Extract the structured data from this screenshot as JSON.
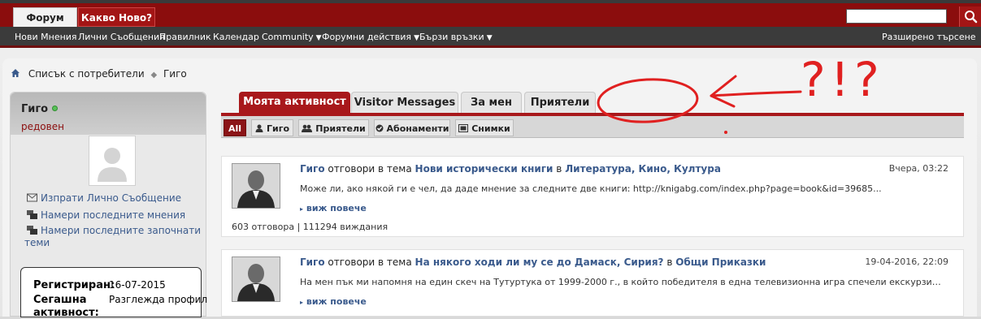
{
  "header": {
    "tabs": [
      {
        "label": "Форум"
      },
      {
        "label": "Какво Ново?"
      }
    ],
    "search_value": ""
  },
  "navbar": {
    "items": [
      {
        "label": "Нови Мнения"
      },
      {
        "label": "Лични Съобщения"
      },
      {
        "label": "Правилник"
      },
      {
        "label": "Календар"
      },
      {
        "label": "Community"
      },
      {
        "label": "Форумни действия"
      },
      {
        "label": "Бързи връзки"
      }
    ],
    "advanced_search": "Разширено търсене"
  },
  "breadcrumb": {
    "parent": "Списък с потребители",
    "current": "Гиго"
  },
  "sidebar": {
    "username": "Гиго",
    "user_title": "редовен",
    "links": [
      {
        "label": "Изпрати Лично Съобщение"
      },
      {
        "label": "Намери последните мнения"
      },
      {
        "label": "Намери последните започнати"
      },
      {
        "label": "теми"
      }
    ],
    "stats": [
      {
        "label": "Регистриран:",
        "value": "16-07-2015"
      },
      {
        "label": "Сегашна",
        "value": "Разглежда профил"
      },
      {
        "label": "активност:"
      }
    ]
  },
  "profile_tabs": [
    {
      "label": "Моята активност"
    },
    {
      "label": "Visitor Messages"
    },
    {
      "label": "За мен"
    },
    {
      "label": "Приятели"
    }
  ],
  "subtabs": [
    {
      "label": "All"
    },
    {
      "label": "Гиго"
    },
    {
      "label": "Приятели"
    },
    {
      "label": "Абонаменти"
    },
    {
      "label": "Снимки"
    }
  ],
  "activity": [
    {
      "user": "Гиго",
      "verb": "отговори в тема",
      "thread": "Нови исторически книги",
      "in": "в",
      "forum": "Литература, Кино, Култура",
      "date": "Вчера, 03:22",
      "snippet": "Може ли, ако някой ги е чел, да даде мнение за следните две книги: http://knigabg.com/index.php?page=book&id=39685...",
      "more": "виж повече",
      "stats": "603 отговора | 111294 виждания"
    },
    {
      "user": "Гиго",
      "verb": "отговори в тема",
      "thread": "На някого ходи ли му се до Дамаск, Сирия?",
      "in": "в",
      "forum": "Общи Приказки",
      "date": "19-04-2016, 22:09",
      "snippet": "На мен пък ми напомня на един скеч на Тутуртука от 1999-2000 г., в който победителя в една телевизионна игра спечели екскурзия до Косово... на...",
      "more": "виж повече"
    }
  ],
  "annotation": {
    "text": "?!?",
    "color": "#e02020"
  },
  "colors": {
    "brand_red": "#8b0d0d",
    "tab_red": "#a8181b",
    "link_blue": "#3a5a8c",
    "nav_dark": "#3b3b3b"
  }
}
